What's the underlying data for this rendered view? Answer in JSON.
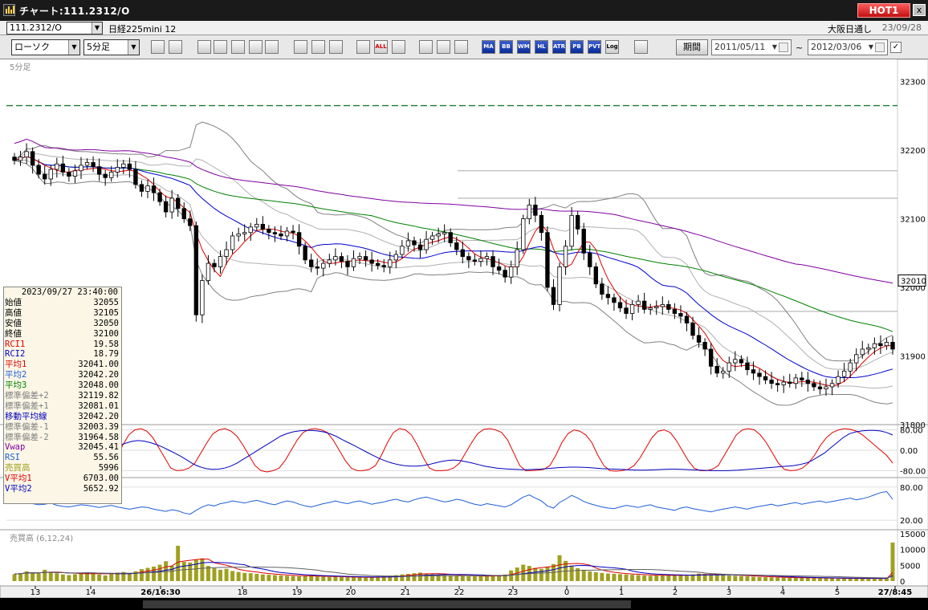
{
  "window": {
    "title": "チャート:111.2312/O",
    "hot_label": "HOT1",
    "close_label": "x"
  },
  "info": {
    "symbol": "111.2312/O",
    "instrument": "日経225mini 12",
    "market": "大阪日通し",
    "date": "23/09/28"
  },
  "toolbar": {
    "chart_type": "ローソク",
    "interval": "5分足",
    "buttons": [
      "",
      "",
      "",
      "",
      "",
      "",
      "",
      "",
      "",
      "",
      "",
      "ALL",
      "",
      "",
      "",
      "",
      "MA",
      "BB",
      "WMA",
      "HL",
      "ATR",
      "PB",
      "PVT",
      "Log",
      ""
    ],
    "period_label": "期間",
    "date_from": "2011/05/11",
    "date_to": "2012/03/06",
    "tilde": "~"
  },
  "colors": {
    "candle_up": "#ffffff",
    "candle_down": "#000000",
    "ma1": "#e00000",
    "ma2": "#0000d0",
    "ma3": "#008000",
    "vwap": "#8000a0",
    "bands": "#808080",
    "rci1": "#e00000",
    "rci2": "#0000c0",
    "rsi": "#1e5ed8",
    "volume": "#a0a020"
  },
  "chart_data": {
    "type": "candlestick",
    "title": "5分足",
    "ylim": [
      31800,
      32330
    ],
    "yticks": [
      "32300",
      "32200",
      "32100",
      "32000",
      "31900",
      "31800"
    ],
    "current_price": "32010",
    "xticks": [
      "13",
      "14",
      "26/16:30",
      "18",
      "19",
      "20",
      "21",
      "22",
      "23",
      "0",
      "1",
      "2",
      "3",
      "4",
      "5",
      "27/8:45"
    ],
    "ref_line": 32265,
    "hlines": [
      32170,
      32130,
      31965
    ],
    "close": [
      32185,
      32190,
      32198,
      32178,
      32165,
      32158,
      32172,
      32180,
      32168,
      32162,
      32170,
      32178,
      32182,
      32176,
      32165,
      32160,
      32168,
      32175,
      32180,
      32172,
      32150,
      32140,
      32148,
      32138,
      32125,
      32110,
      32130,
      32115,
      32100,
      32090,
      31960,
      32010,
      32035,
      32030,
      32045,
      32055,
      32075,
      32078,
      32080,
      32088,
      32092,
      32085,
      32080,
      32078,
      32075,
      32082,
      32080,
      32060,
      32040,
      32030,
      32028,
      32035,
      32040,
      32045,
      32038,
      32030,
      32042,
      32045,
      32040,
      32035,
      32032,
      32030,
      32040,
      32048,
      32060,
      32068,
      32062,
      32055,
      32070,
      32075,
      32078,
      32080,
      32065,
      32055,
      32045,
      32040,
      32038,
      32042,
      32045,
      32030,
      32025,
      32015,
      32030,
      32055,
      32100,
      32120,
      32105,
      32080,
      32000,
      31975,
      32030,
      32060,
      32105,
      32085,
      32050,
      32030,
      32005,
      31990,
      31985,
      31978,
      31970,
      31962,
      31975,
      31980,
      31968,
      31970,
      31972,
      31975,
      31968,
      31962,
      31958,
      31948,
      31930,
      31920,
      31910,
      31885,
      31875,
      31878,
      31890,
      31895,
      31890,
      31880,
      31875,
      31870,
      31865,
      31860,
      31858,
      31862,
      31860,
      31868,
      31865,
      31860,
      31855,
      31852,
      31855,
      31860,
      31870,
      31878,
      31890,
      31902,
      31910,
      31912,
      31918,
      31915,
      31920,
      31910
    ],
    "volume_title": "売買高 (6,12,24)",
    "volume_ylim": [
      0,
      15000
    ],
    "volume_yticks": [
      "15000",
      "10000",
      "5000",
      "0"
    ],
    "volume": [
      2200,
      2500,
      3100,
      2800,
      2400,
      3600,
      2900,
      2500,
      2100,
      1900,
      2200,
      2600,
      2800,
      2400,
      2100,
      1800,
      2300,
      2700,
      2900,
      2400,
      3100,
      3800,
      4200,
      4600,
      5200,
      6300,
      4800,
      11200,
      6100,
      5900,
      6800,
      7200,
      4800,
      4100,
      3600,
      3900,
      3200,
      2900,
      2600,
      2500,
      2300,
      2100,
      2000,
      1900,
      1800,
      1700,
      1600,
      1500,
      1600,
      1700,
      1500,
      1400,
      1300,
      1400,
      1300,
      1200,
      1250,
      1150,
      1100,
      1300,
      1400,
      1500,
      1700,
      1900,
      2100,
      2300,
      2500,
      2700,
      2400,
      2200,
      2000,
      1900,
      1800,
      1700,
      1600,
      1500,
      1500,
      1600,
      1700,
      1800,
      1900,
      2100,
      3400,
      4300,
      5200,
      4800,
      4200,
      3900,
      4500,
      5400,
      8200,
      6400,
      4900,
      4100,
      3600,
      3100,
      2800,
      2600,
      2400,
      2300,
      2200,
      2100,
      2000,
      1900,
      1800,
      1700,
      1800,
      1900,
      2000,
      1900,
      1800,
      1700,
      2100,
      2400,
      2300,
      2200,
      2000,
      1900,
      1800,
      1700,
      1600,
      1500,
      1400,
      1300,
      1250,
      1200,
      1150,
      1100,
      1050,
      1000,
      1050,
      1100,
      1000,
      900,
      950,
      850,
      800,
      900,
      1000,
      900,
      800,
      750,
      700,
      800,
      900,
      12200
    ]
  },
  "rci": {
    "yticks": [
      "80.00",
      "0.00",
      "-80.00"
    ],
    "rci1": [
      -80,
      -75,
      -60,
      -30,
      10,
      50,
      75,
      85,
      80,
      60,
      30,
      -10,
      -50,
      -75,
      -80,
      -75,
      -60,
      -30,
      20,
      60,
      80,
      85,
      75,
      50,
      10,
      -30,
      -70,
      -80,
      -78,
      -70,
      -50,
      -10,
      30,
      65,
      80,
      85,
      75,
      55,
      20,
      -20,
      -60,
      -80,
      -85,
      -80,
      -70,
      -40,
      0,
      40,
      70,
      82,
      85,
      80,
      70,
      40,
      0,
      -40,
      -70,
      -80,
      -80,
      -75,
      -60,
      -20,
      30,
      70,
      85,
      80,
      60,
      20,
      -30,
      -70,
      -80,
      -80,
      -78,
      -70,
      -50,
      -10,
      30,
      65,
      82,
      85,
      80,
      70,
      40,
      -10,
      -60,
      -80,
      -80,
      -78,
      -75,
      -60,
      -20,
      30,
      65,
      80,
      75,
      60,
      30,
      -20,
      -60,
      -80,
      -82,
      -80,
      -75,
      -60,
      -30,
      10,
      50,
      75,
      80,
      70,
      40,
      0,
      -40,
      -70,
      -80,
      -80,
      -75,
      -60,
      -20,
      20,
      60,
      80,
      85,
      80,
      60,
      30,
      -10,
      -50,
      -75,
      -80,
      -78,
      -70,
      -50,
      -20,
      20,
      50,
      70,
      80,
      85,
      82,
      75,
      60,
      40,
      20,
      0,
      -20,
      -50
    ],
    "rci2": [
      -60,
      -62,
      -65,
      -68,
      -70,
      -70,
      -68,
      -64,
      -58,
      -50,
      -42,
      -35,
      -28,
      -20,
      -10,
      0,
      10,
      20,
      28,
      35,
      38,
      36,
      30,
      22,
      12,
      0,
      -12,
      -25,
      -40,
      -55,
      -65,
      -72,
      -75,
      -74,
      -70,
      -62,
      -50,
      -35,
      -20,
      -5,
      10,
      25,
      40,
      55,
      65,
      72,
      76,
      78,
      78,
      76,
      72,
      65,
      55,
      42,
      30,
      18,
      5,
      -8,
      -20,
      -32,
      -42,
      -50,
      -56,
      -60,
      -62,
      -62,
      -60,
      -56,
      -50,
      -44,
      -40,
      -38,
      -40,
      -45,
      -50,
      -56,
      -62,
      -66,
      -70,
      -72,
      -74,
      -75,
      -76,
      -76,
      -75,
      -74,
      -72,
      -70,
      -68,
      -67,
      -66,
      -66,
      -67,
      -68,
      -70,
      -72,
      -73,
      -74,
      -75,
      -76,
      -77,
      -78,
      -78,
      -77,
      -76,
      -75,
      -74,
      -74,
      -75,
      -76,
      -77,
      -78,
      -79,
      -80,
      -80,
      -80,
      -79,
      -78,
      -76,
      -74,
      -72,
      -70,
      -68,
      -66,
      -64,
      -62,
      -60,
      -56,
      -50,
      -40,
      -25,
      -10,
      10,
      30,
      50,
      65,
      72,
      76,
      78,
      78,
      76,
      70,
      60
    ],
    "rsi_yticks": [
      "80.00",
      "20.00"
    ],
    "rsi": [
      52,
      54,
      53,
      50,
      48,
      49,
      51,
      47,
      45,
      44,
      46,
      48,
      47,
      45,
      43,
      45,
      47,
      44,
      42,
      40,
      42,
      44,
      43,
      40,
      38,
      36,
      39,
      37,
      33,
      31,
      38,
      44,
      48,
      46,
      50,
      52,
      55,
      53,
      51,
      54,
      56,
      53,
      50,
      48,
      52,
      55,
      53,
      49,
      46,
      44,
      47,
      50,
      52,
      55,
      52,
      50,
      53,
      55,
      52,
      49,
      51,
      53,
      56,
      58,
      55,
      53,
      57,
      60,
      62,
      59,
      56,
      53,
      55,
      58,
      56,
      52,
      49,
      47,
      50,
      48,
      46,
      44,
      48,
      55,
      62,
      66,
      60,
      55,
      46,
      42,
      52,
      58,
      65,
      60,
      54,
      50,
      47,
      44,
      42,
      41,
      44,
      47,
      45,
      43,
      46,
      48,
      44,
      42,
      40,
      38,
      42,
      44,
      41,
      39,
      37,
      35,
      38,
      40,
      42,
      44,
      42,
      40,
      43,
      45,
      47,
      49,
      46,
      48,
      50,
      52,
      49,
      51,
      53,
      55,
      52,
      54,
      56,
      58,
      60,
      57,
      59,
      62,
      66,
      70,
      72,
      58
    ]
  },
  "databox": {
    "datetime": "2023/09/27  23:40:00",
    "rows": [
      {
        "label": "始値",
        "value": "32055",
        "color": "#000000"
      },
      {
        "label": "高値",
        "value": "32105",
        "color": "#000000"
      },
      {
        "label": "安値",
        "value": "32050",
        "color": "#000000"
      },
      {
        "label": "終値",
        "value": "32100",
        "color": "#000000"
      },
      {
        "label": "RCI1",
        "value": "19.58",
        "color": "#e00000"
      },
      {
        "label": "RCI2",
        "value": "18.79",
        "color": "#0000c0"
      },
      {
        "label": "平均1",
        "value": "32041.00",
        "color": "#e00000"
      },
      {
        "label": "平均2",
        "value": "32042.20",
        "color": "#1e5ed8"
      },
      {
        "label": "平均3",
        "value": "32048.00",
        "color": "#008000"
      },
      {
        "label": "標準偏差+2",
        "value": "32119.82",
        "color": "#808080"
      },
      {
        "label": "標準偏差+1",
        "value": "32081.01",
        "color": "#808080"
      },
      {
        "label": "移動平均線",
        "value": "32042.20",
        "color": "#0000c0"
      },
      {
        "label": "標準偏差-1",
        "value": "32003.39",
        "color": "#808080"
      },
      {
        "label": "標準偏差-2",
        "value": "31964.58",
        "color": "#808080"
      },
      {
        "label": "Vwap",
        "value": "32045.41",
        "color": "#8000a0"
      },
      {
        "label": "RSI",
        "value": "55.56",
        "color": "#1e5ed8"
      },
      {
        "label": "売買高",
        "value": "5996",
        "color": "#a0a020"
      },
      {
        "label": "V平均1",
        "value": "6703.00",
        "color": "#e00000"
      },
      {
        "label": "V平均2",
        "value": "5652.92",
        "color": "#0000c0"
      }
    ]
  }
}
